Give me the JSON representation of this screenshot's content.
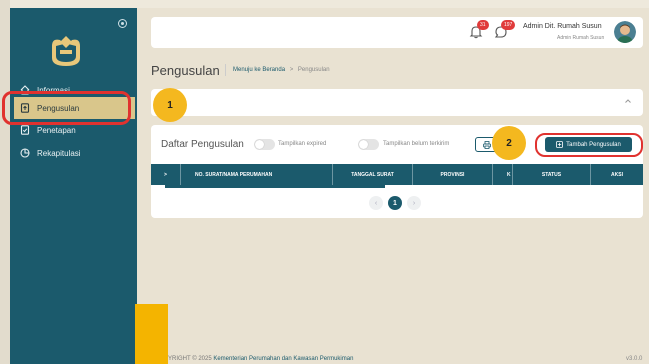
{
  "sidebar": {
    "menu": [
      {
        "label": "Informasi",
        "icon": "home-icon"
      },
      {
        "label": "Pengusulan",
        "icon": "document-upload-icon",
        "active": true
      },
      {
        "label": "Penetapan",
        "icon": "document-check-icon"
      },
      {
        "label": "Rekapitulasi",
        "icon": "pie-chart-icon"
      }
    ]
  },
  "header": {
    "notifications_count": "31",
    "messages_count": "197",
    "user_name": "Admin Dit. Rumah Susun",
    "user_role": "Admin Rumah Susun"
  },
  "page": {
    "title": "Pengusulan",
    "breadcrumb_home": "Menuju ke Beranda",
    "breadcrumb_sep": ">",
    "breadcrumb_current": "Pengusulan"
  },
  "table_card": {
    "title": "Daftar Pengusulan",
    "toggle_expired_label": "Tampilkan expired",
    "toggle_unsent_label": "Tampilkan belum terkirim",
    "add_button_label": "Tambah Pengusulan",
    "columns": [
      ">",
      "NO. SURAT/NAMA PERUMAHAN",
      "TANGGAL SURAT",
      "PROVINSI",
      "K",
      "STATUS",
      "AKSI"
    ],
    "pagination": {
      "prev": "‹",
      "current": "1",
      "next": "›"
    }
  },
  "annotations": {
    "step1": "1",
    "step2": "2"
  },
  "footer": {
    "copyright_prefix": "YRIGHT © 2025",
    "copyright_org": "Kementerian Perumahan dan Kawasan Permukiman",
    "version": "v3.0.0"
  },
  "colors": {
    "primary": "#1b5a6c",
    "active_menu": "#d9c68b",
    "callout": "#e0322f",
    "step_marker": "#f4b81f",
    "badge": "#e03b3b"
  }
}
